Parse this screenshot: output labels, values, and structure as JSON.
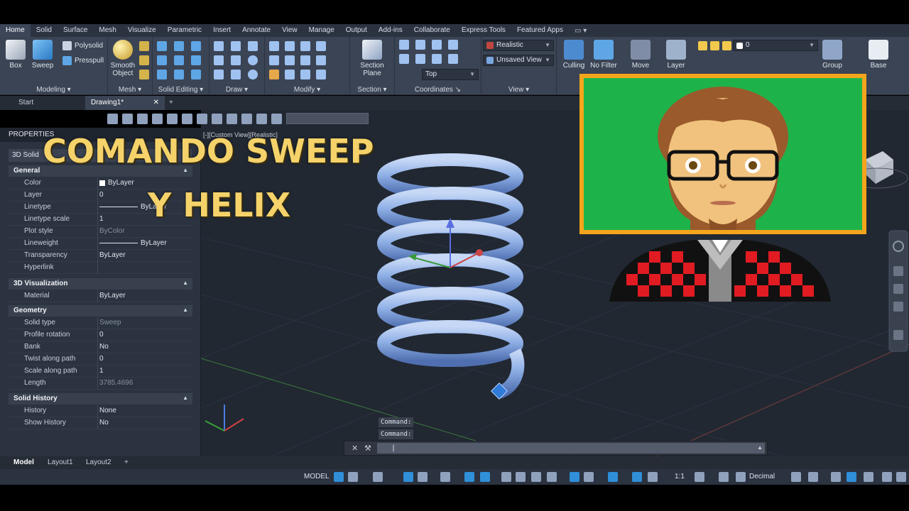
{
  "ribbon_tabs": [
    "Home",
    "Solid",
    "Surface",
    "Mesh",
    "Visualize",
    "Parametric",
    "Insert",
    "Annotate",
    "View",
    "Manage",
    "Output",
    "Add-ins",
    "Collaborate",
    "Express Tools",
    "Featured Apps"
  ],
  "ribbon": {
    "modeling": {
      "title": "Modeling",
      "box": "Box",
      "sweep": "Sweep",
      "polysolid": "Polysolid",
      "presspull": "Presspull"
    },
    "mesh": {
      "title": "Mesh",
      "smooth_object_1": "Smooth",
      "smooth_object_2": "Object"
    },
    "solid_editing": {
      "title": "Solid Editing"
    },
    "draw": {
      "title": "Draw"
    },
    "modify": {
      "title": "Modify"
    },
    "section": {
      "title": "Section",
      "section_plane_1": "Section",
      "section_plane_2": "Plane"
    },
    "coordinates": {
      "title": "Coordinates",
      "ucs_value": "Top"
    },
    "view": {
      "title": "View",
      "visual_style": "Realistic",
      "saved_view": "Unsaved View"
    },
    "culling": "Culling",
    "no_filter": "No Filter",
    "move_gizmo": "Move",
    "layer_properties": "Layer",
    "layer_value": "0",
    "group": "Group",
    "base": "Base"
  },
  "file_tabs": {
    "start": "Start",
    "drawing": "Drawing1*"
  },
  "view_label": "[-][Custom View][Realistic]",
  "properties": {
    "header": "PROPERTIES",
    "object": "3D Solid",
    "general": {
      "title": "General",
      "rows": [
        {
          "k": "Color",
          "v": "ByLayer"
        },
        {
          "k": "Layer",
          "v": "0"
        },
        {
          "k": "Linetype",
          "v": "ByLayer"
        },
        {
          "k": "Linetype scale",
          "v": "1"
        },
        {
          "k": "Plot style",
          "v": "ByColor"
        },
        {
          "k": "Lineweight",
          "v": "ByLayer"
        },
        {
          "k": "Transparency",
          "v": "ByLayer"
        },
        {
          "k": "Hyperlink",
          "v": ""
        }
      ]
    },
    "visualization": {
      "title": "3D Visualization",
      "rows": [
        {
          "k": "Material",
          "v": "ByLayer"
        }
      ]
    },
    "geometry": {
      "title": "Geometry",
      "rows": [
        {
          "k": "Solid type",
          "v": "Sweep"
        },
        {
          "k": "Profile rotation",
          "v": "0"
        },
        {
          "k": "Bank",
          "v": "No"
        },
        {
          "k": "Twist along path",
          "v": "0"
        },
        {
          "k": "Scale along path",
          "v": "1"
        },
        {
          "k": "Length",
          "v": "3785.4696"
        }
      ]
    },
    "history": {
      "title": "Solid History",
      "rows": [
        {
          "k": "History",
          "v": "None"
        },
        {
          "k": "Show History",
          "v": "No"
        }
      ]
    }
  },
  "overlay": {
    "line1": "COMANDO SWEEP",
    "line2": "Y HELIX"
  },
  "command": {
    "hist1": "Command:",
    "hist2": "Command:",
    "input": "|"
  },
  "layout_tabs": [
    "Model",
    "Layout1",
    "Layout2"
  ],
  "status": {
    "model": "MODEL",
    "scale": "1:1",
    "units": "Decimal"
  },
  "colors": {
    "accent": "#f5a51b",
    "green_screen": "#1eb34a",
    "spring": "#8fb0e6"
  }
}
